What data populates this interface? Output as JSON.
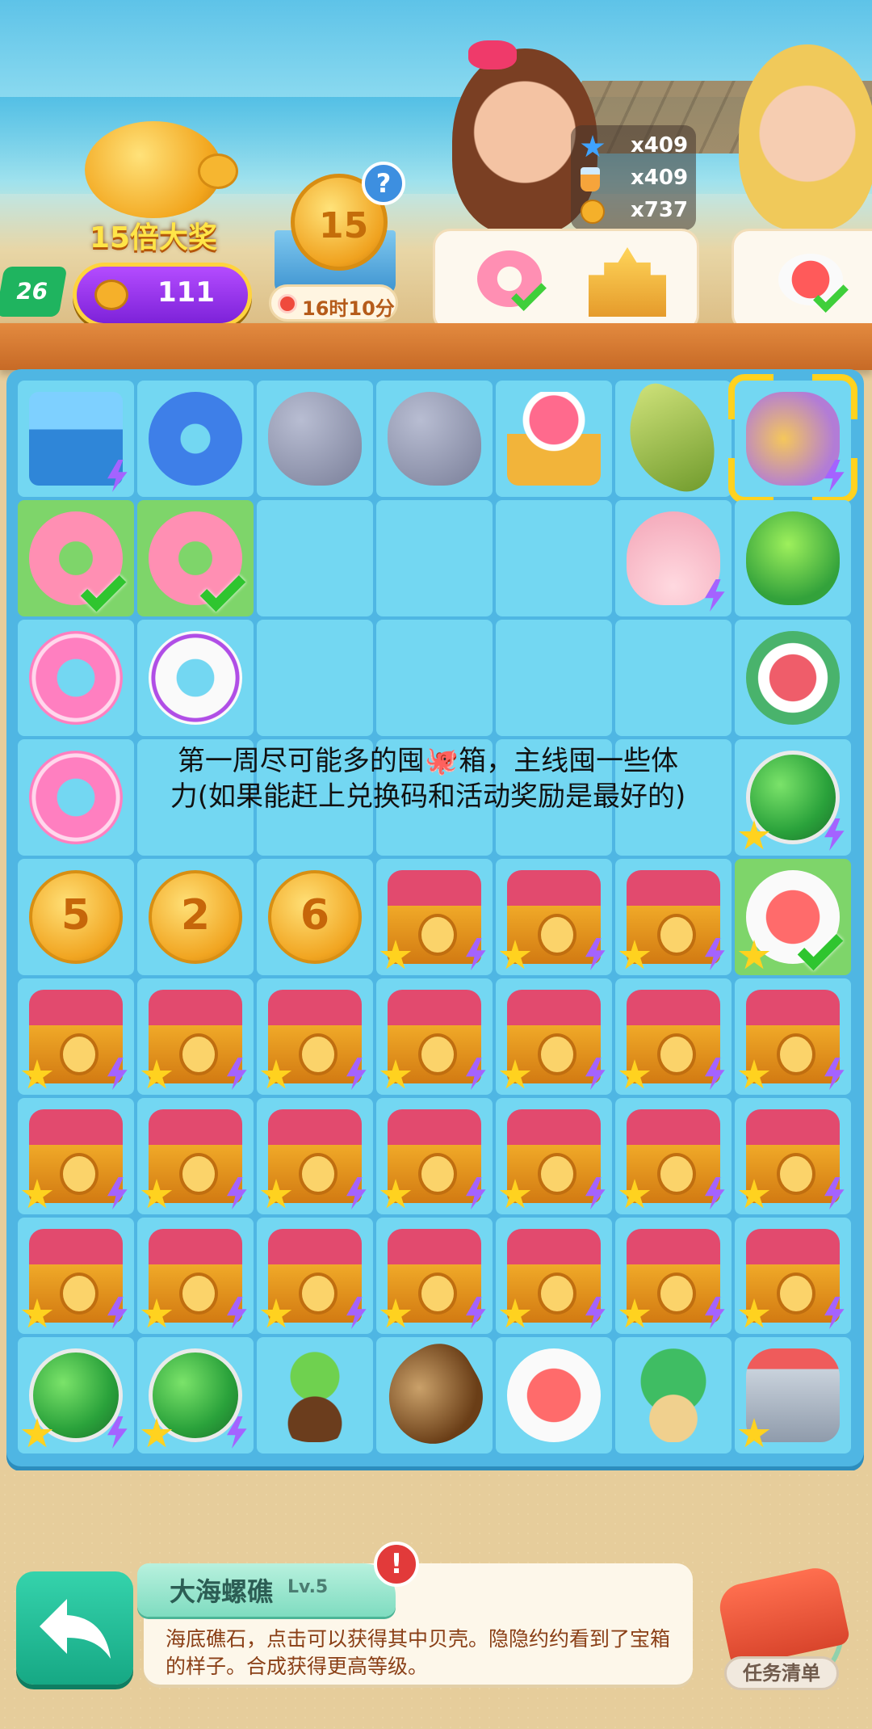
{
  "hud": {
    "level": "26",
    "bonus_banner": "15倍大奖",
    "bean_count": "111",
    "medal_number": "15",
    "question_mark": "?",
    "timer": "16时10分",
    "resources": [
      {
        "icon": "star-icon",
        "value": "x409"
      },
      {
        "icon": "juice-icon",
        "value": "x409"
      },
      {
        "icon": "bean-icon",
        "value": "x737"
      }
    ]
  },
  "orders": [
    {
      "items": [
        "flamingo-float-icon",
        "sandcastle-icon"
      ],
      "completed_item": "flamingo-float-icon"
    },
    {
      "items": [
        "watermelon-plate-icon"
      ],
      "completed_item": "watermelon-plate-icon"
    }
  ],
  "board": {
    "rows": [
      [
        "surf-cart",
        "dolphin-float",
        "rock",
        "mossy-rock",
        "ring-cart",
        "conch-shell",
        "reef-coral"
      ],
      [
        "flamingo-float",
        "flamingo-float",
        "",
        "",
        "",
        "scallop-shell",
        "parrot"
      ],
      [
        "pink-donut-float",
        "purple-life-ring",
        "",
        "",
        "",
        "",
        "fruit-tea"
      ],
      [
        "beach-ball-ring",
        "",
        "",
        "",
        "",
        "",
        "watermelon-tray"
      ],
      [
        "coin-5",
        "coin-2",
        "coin-6",
        "octopus-chest",
        "octopus-chest",
        "octopus-chest",
        "watermelon-plate"
      ],
      [
        "octopus-chest",
        "octopus-chest",
        "octopus-chest",
        "octopus-chest",
        "octopus-chest",
        "octopus-chest",
        "octopus-chest"
      ],
      [
        "octopus-chest",
        "octopus-chest",
        "octopus-chest",
        "octopus-chest",
        "octopus-chest",
        "octopus-chest",
        "octopus-chest"
      ],
      [
        "octopus-chest",
        "octopus-chest",
        "octopus-chest",
        "octopus-chest",
        "octopus-chest",
        "octopus-chest",
        "octopus-chest"
      ],
      [
        "melon-basket",
        "melon-basket",
        "sprout",
        "seed",
        "juice-plate",
        "potted-plant",
        "juicer"
      ]
    ],
    "coin_values": {
      "coin-5": "5",
      "coin-2": "2",
      "coin-6": "6"
    },
    "selected_item": "reef-coral"
  },
  "overlay_hint": {
    "line1": "第一周尽可能多的囤🐙箱，主线囤一些体",
    "line2": "力(如果能赶上兑换码和活动奖励是最好的)"
  },
  "info_panel": {
    "title": "大海螺礁",
    "level": "Lv.5",
    "alert": "!",
    "description": "海底礁石，点击可以获得其中贝壳。隐隐约约看到了宝箱的样子。合成获得更高等级。"
  },
  "task_list_label": "任务清单",
  "colors": {
    "board": "#4fb6e3",
    "cell": "#73d7f2",
    "done_cell": "#7ed56a",
    "accent_green": "#16a884"
  }
}
